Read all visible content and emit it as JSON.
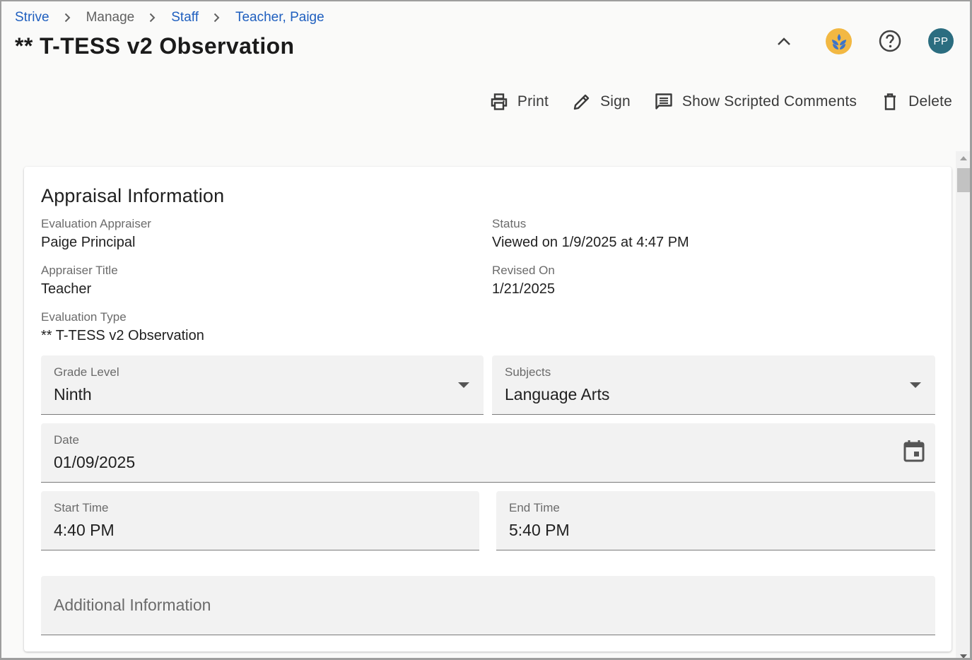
{
  "breadcrumb": {
    "items": [
      {
        "label": "Strive",
        "link": true
      },
      {
        "label": "Manage",
        "link": false
      },
      {
        "label": "Staff",
        "link": true
      },
      {
        "label": "Teacher, Paige",
        "link": true
      }
    ]
  },
  "page_title": "** T-TESS v2 Observation",
  "header": {
    "avatar_initials": "PP",
    "icons": [
      "chevron-up-icon",
      "app-logo-icon",
      "help-icon"
    ]
  },
  "toolbar": {
    "print_label": "Print",
    "sign_label": "Sign",
    "scripted_label": "Show Scripted Comments",
    "delete_label": "Delete"
  },
  "appraisal": {
    "title": "Appraisal Information",
    "evaluation_appraiser_label": "Evaluation Appraiser",
    "evaluation_appraiser_value": "Paige Principal",
    "status_label": "Status",
    "status_value": "Viewed on 1/9/2025 at 4:47 PM",
    "appraiser_title_label": "Appraiser Title",
    "appraiser_title_value": "Teacher",
    "revised_on_label": "Revised On",
    "revised_on_value": "1/21/2025",
    "evaluation_type_label": "Evaluation Type",
    "evaluation_type_value": "** T-TESS v2 Observation"
  },
  "form": {
    "grade_level_label": "Grade Level",
    "grade_level_value": "Ninth",
    "subjects_label": "Subjects",
    "subjects_value": "Language Arts",
    "date_label": "Date",
    "date_value": "01/09/2025",
    "start_time_label": "Start Time",
    "start_time_value": "4:40 PM",
    "end_time_label": "End Time",
    "end_time_value": "5:40 PM",
    "additional_info_placeholder": "Additional Information"
  },
  "colors": {
    "link": "#1f5fbf",
    "avatar_bg": "#2b6d80",
    "logo_bg": "#f2b843",
    "logo_fg": "#3d74c9",
    "input_bg": "#f2f2f2"
  }
}
